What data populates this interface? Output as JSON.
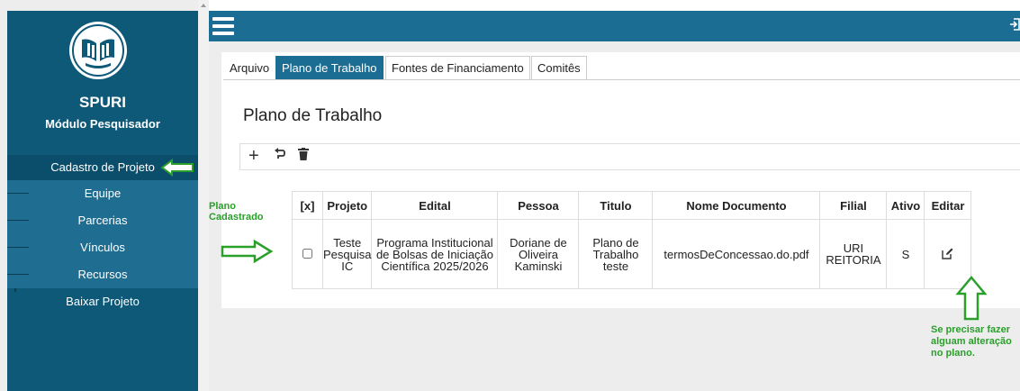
{
  "app": {
    "name": "SPURI",
    "module": "Módulo Pesquisador"
  },
  "sidebar": {
    "items": [
      {
        "label": "Cadastro de Projeto"
      },
      {
        "label": "Equipe"
      },
      {
        "label": "Parcerias"
      },
      {
        "label": "Vínculos"
      },
      {
        "label": "Recursos"
      },
      {
        "label": "Baixar Projeto"
      }
    ]
  },
  "tabs": [
    "Arquivo",
    "Plano de Trabalho",
    "Fontes de Financiamento",
    "Comitês"
  ],
  "active_tab": "Plano de Trabalho",
  "page_title": "Plano de Trabalho",
  "toolbar": {
    "add": "+",
    "undo": "↶",
    "delete": "🗑"
  },
  "table": {
    "headers": [
      "[x]",
      "Projeto",
      "Edital",
      "Pessoa",
      "Titulo",
      "Nome Documento",
      "Filial",
      "Ativo",
      "Editar"
    ],
    "rows": [
      {
        "projeto": "Teste Pesquisa IC",
        "edital": "Programa Institucional de Bolsas de Iniciação Científica 2025/2026",
        "pessoa": "Doriane de Oliveira Kaminski",
        "titulo": "Plano de Trabalho teste",
        "documento": "termosDeConcessao.do.pdf",
        "filial": "URI REITORIA",
        "ativo": "S"
      }
    ]
  },
  "annotations": {
    "plano": "Plano Cadastrado",
    "change": "Se precisar fazer alguam alteração no plano."
  },
  "colors": {
    "sidebar": "#0e5878",
    "topbar": "#1c6d93",
    "annotation": "#2aa02a"
  },
  "icons": [
    "menu-icon",
    "logout-icon",
    "add-icon",
    "undo-icon",
    "trash-icon",
    "edit-icon"
  ]
}
